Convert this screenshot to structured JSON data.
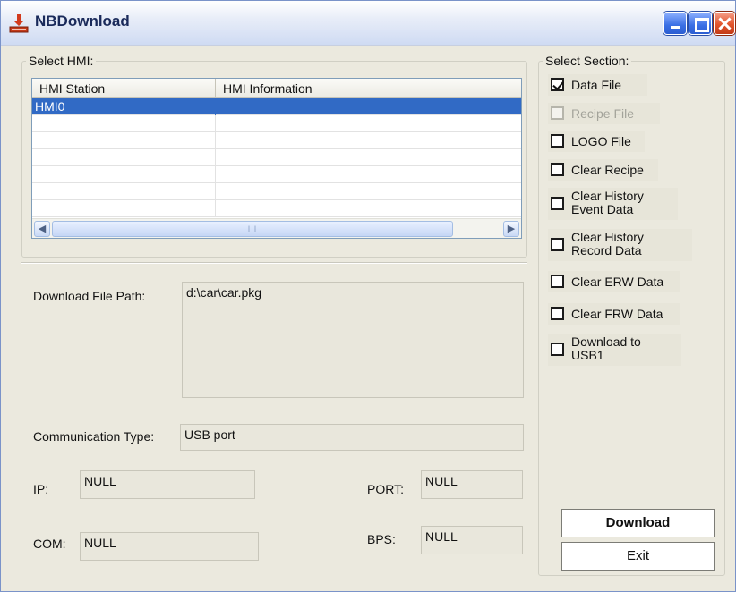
{
  "window": {
    "title": "NBDownload"
  },
  "hmi_group": {
    "legend": "Select HMI:",
    "columns": [
      "HMI Station",
      "HMI Information"
    ],
    "rows": [
      {
        "station": "HMI0",
        "info": ""
      },
      {
        "station": "",
        "info": ""
      },
      {
        "station": "",
        "info": ""
      },
      {
        "station": "",
        "info": ""
      },
      {
        "station": "",
        "info": ""
      },
      {
        "station": "",
        "info": ""
      },
      {
        "station": "",
        "info": ""
      }
    ],
    "selected_row": 0,
    "scrollbar_grip": "III"
  },
  "fields": {
    "download_path_label": "Download File Path:",
    "download_path_value": "d:\\car\\car.pkg",
    "comm_type_label": "Communication Type:",
    "comm_type_value": "USB port",
    "ip_label": "IP:",
    "ip_value": "NULL",
    "port_label": "PORT:",
    "port_value": "NULL",
    "com_label": "COM:",
    "com_value": "NULL",
    "bps_label": "BPS:",
    "bps_value": "NULL"
  },
  "section_group": {
    "legend": "Select Section:",
    "items": [
      {
        "label": "Data File",
        "checked": true,
        "enabled": true
      },
      {
        "label": "Recipe File",
        "checked": false,
        "enabled": false
      },
      {
        "label": "LOGO File",
        "checked": false,
        "enabled": true
      },
      {
        "label": "Clear Recipe",
        "checked": false,
        "enabled": true
      },
      {
        "label": "Clear History",
        "label2": "Event Data",
        "checked": false,
        "enabled": true
      },
      {
        "label": "Clear History",
        "label2": "Record Data",
        "checked": false,
        "enabled": true
      },
      {
        "label": "Clear ERW Data",
        "checked": false,
        "enabled": true
      },
      {
        "label": "Clear FRW Data",
        "checked": false,
        "enabled": true
      },
      {
        "label": "Download to",
        "label2": "USB1",
        "checked": false,
        "enabled": true
      }
    ]
  },
  "buttons": {
    "download": "Download",
    "exit": "Exit"
  },
  "colors": {
    "selection": "#316ac5",
    "window_bg": "#ebe9de"
  },
  "icons": {
    "app": "download-app-icon",
    "minimize": "minimize-icon",
    "maximize": "maximize-icon",
    "close": "close-icon"
  }
}
